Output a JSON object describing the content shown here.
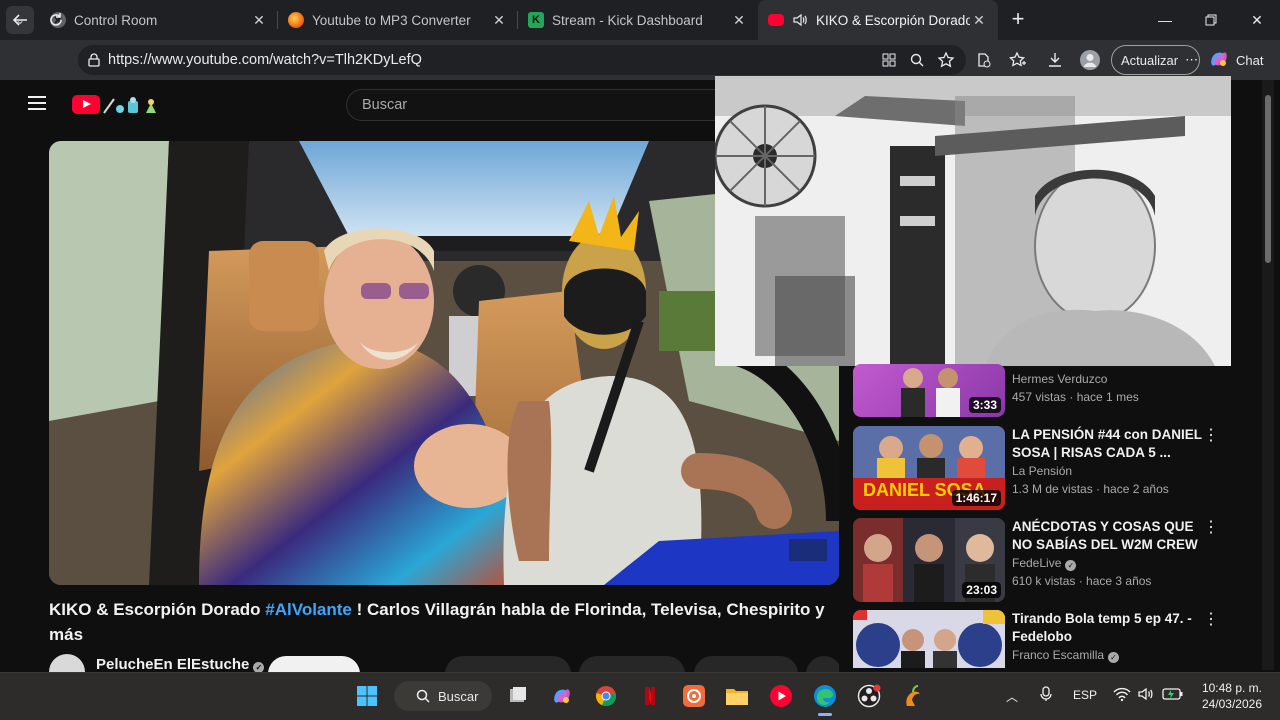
{
  "browser": {
    "tabs": [
      {
        "title": "Control Room",
        "active": false
      },
      {
        "title": "Youtube to MP3 Converter",
        "active": false
      },
      {
        "title": "Stream - Kick Dashboard",
        "active": false
      },
      {
        "title": "KIKO & Escorpión Dorado #Al",
        "active": true
      }
    ],
    "url": "https://www.youtube.com/watch?v=Tlh2KDyLefQ",
    "update_label": "Actualizar",
    "chat_label": "Chat"
  },
  "youtube": {
    "search_placeholder": "Buscar",
    "video": {
      "title_prefix": "KIKO & Escorpión Dorado ",
      "hashtag": "#AlVolante",
      "title_suffix": " ! Carlos Villagrán habla de Florinda, Televisa, Chespirito y más",
      "channel": "PelucheEn ElEstuche"
    },
    "recommendations": [
      {
        "title": "",
        "channel": "Hermes Verduzco",
        "verified": false,
        "views": "457 vistas",
        "age": "hace 1 mes",
        "duration": "3:33"
      },
      {
        "title": "LA PENSIÓN #44 con DANIEL SOSA | RISAS CADA 5 ...",
        "channel": "La Pensión",
        "verified": false,
        "views": "1.3 M de vistas",
        "age": "hace 2 años",
        "duration": "1:46:17",
        "thumb_text": "DANIEL SOSA"
      },
      {
        "title": "ANÉCDOTAS Y COSAS QUE NO SABÍAS DEL W2M CREW",
        "channel": "FedeLive",
        "verified": true,
        "views": "610 k vistas",
        "age": "hace 3 años",
        "duration": "23:03"
      },
      {
        "title": "Tirando Bola temp 5 ep 47. - Fedelobo",
        "channel": "Franco Escamilla",
        "verified": true,
        "views": "",
        "age": "",
        "duration": ""
      }
    ]
  },
  "taskbar": {
    "search_label": "Buscar",
    "language": "ESP",
    "time": "10:48 p. m.",
    "date": "24/03/2026"
  },
  "colors": {
    "youtube_red": "#ff0033",
    "link_blue": "#3ea6ff",
    "page_bg": "#0f0f0f",
    "taskbar_bg": "#2d2c2a"
  }
}
